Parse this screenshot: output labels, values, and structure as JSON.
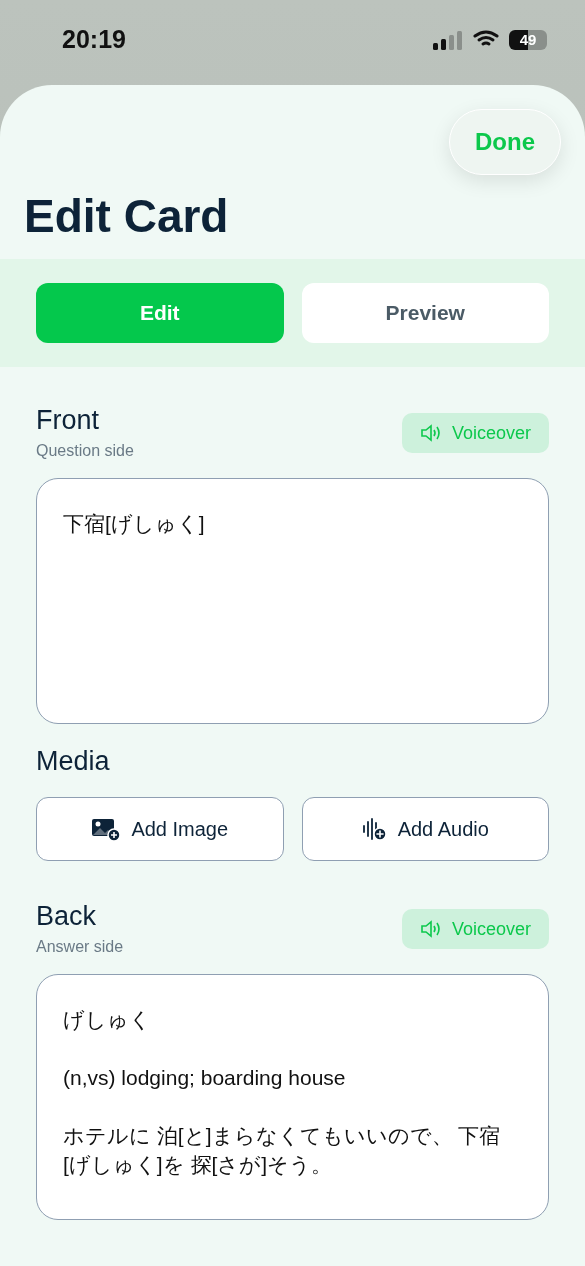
{
  "status_bar": {
    "time": "20:19",
    "battery": "49"
  },
  "done_button": "Done",
  "title": "Edit Card",
  "tabs": [
    {
      "label": "Edit",
      "selected": true
    },
    {
      "label": "Preview",
      "selected": false
    }
  ],
  "front": {
    "heading": "Front",
    "subtitle": "Question side",
    "voiceover": "Voiceover",
    "value": "下宿[げしゅく]"
  },
  "media": {
    "heading": "Media",
    "buttons": [
      {
        "kind": "image",
        "label": "Add Image"
      },
      {
        "kind": "audio",
        "label": "Add Audio"
      }
    ]
  },
  "back": {
    "heading": "Back",
    "subtitle": "Answer side",
    "voiceover": "Voiceover",
    "value": "げしゅく\n\n(n,vs) lodging; boarding house\n\nホテルに 泊[と]まらなくてもいいので、 下宿[げしゅく]を 探[さが]そう。"
  }
}
